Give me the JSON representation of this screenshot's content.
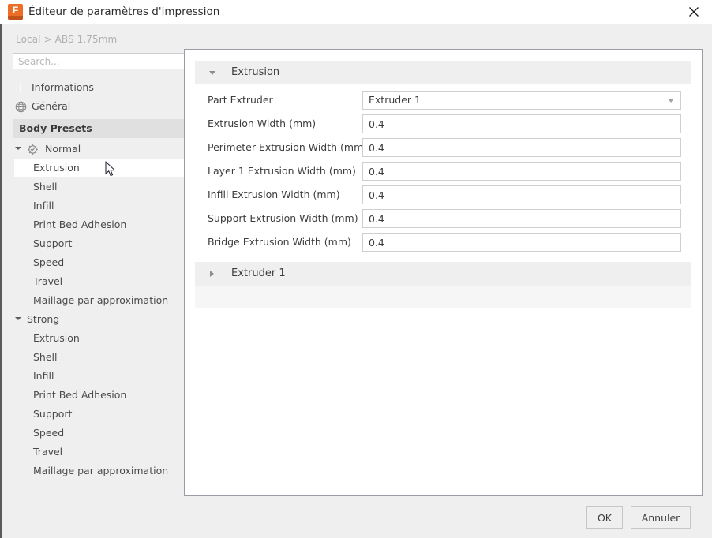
{
  "window": {
    "title": "Éditeur de paramètres d'impression",
    "app_icon": "fusion-app-icon",
    "icon_letter": "F",
    "icon_color": "#ec6d26",
    "close_icon": "close-icon"
  },
  "sidebar": {
    "breadcrumb": "Local > ABS 1.75mm",
    "search": {
      "value": "",
      "placeholder": "Search..."
    },
    "top_items": [
      {
        "label": "Informations",
        "icon": "info-icon"
      },
      {
        "label": "Général",
        "icon": "globe-icon"
      }
    ],
    "section_header": "Body Presets",
    "groups": [
      {
        "label": "Normal",
        "icon": "gear-check-icon",
        "expanded": true,
        "children": [
          "Extrusion",
          "Shell",
          "Infill",
          "Print Bed Adhesion",
          "Support",
          "Speed",
          "Travel",
          "Maillage par approximation"
        ]
      },
      {
        "label": "Strong",
        "icon": "",
        "expanded": true,
        "children": [
          "Extrusion",
          "Shell",
          "Infill",
          "Print Bed Adhesion",
          "Support",
          "Speed",
          "Travel",
          "Maillage par approximation"
        ]
      }
    ],
    "selected": "Extrusion"
  },
  "content": {
    "section": {
      "title": "Extrusion",
      "expanded": true,
      "collapse_icon": "chevron-down-icon"
    },
    "fields": [
      {
        "label": "Part Extruder",
        "value": "Extruder 1",
        "type": "select"
      },
      {
        "label": "Extrusion Width (mm)",
        "value": "0.4",
        "type": "text"
      },
      {
        "label": "Perimeter Extrusion Width (mm)",
        "value": "0.4",
        "type": "text"
      },
      {
        "label": "Layer 1 Extrusion Width (mm)",
        "value": "0.4",
        "type": "text"
      },
      {
        "label": "Infill Extrusion Width (mm)",
        "value": "0.4",
        "type": "text"
      },
      {
        "label": "Support Extrusion Width (mm)",
        "value": "0.4",
        "type": "text"
      },
      {
        "label": "Bridge Extrusion Width (mm)",
        "value": "0.4",
        "type": "text"
      }
    ],
    "collapsed_section": {
      "title": "Extruder 1",
      "expanded": false,
      "expand_icon": "chevron-right-icon"
    }
  },
  "footer": {
    "ok_label": "OK",
    "cancel_label": "Annuler"
  }
}
